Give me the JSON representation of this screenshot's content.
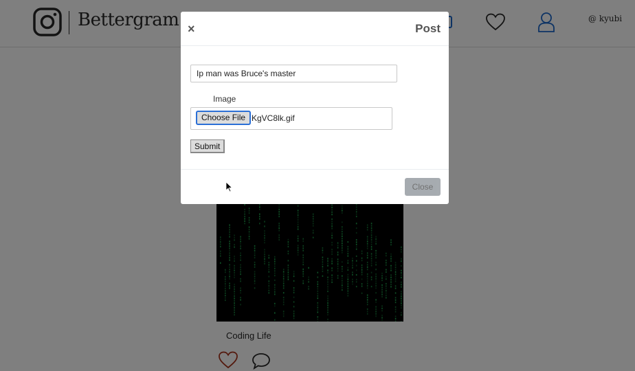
{
  "app": {
    "brand": "Bettergram"
  },
  "nav": {
    "user_handle": "@ kyubi",
    "icons": [
      "instagram-logo-icon",
      "heart-icon",
      "user-icon"
    ]
  },
  "feed": {
    "post": {
      "caption": "Coding Life",
      "image": "matrix-code-gif"
    }
  },
  "modal": {
    "title": "Post",
    "close_x": "×",
    "caption_value": "Ip man was Bruce's master",
    "image_label": "Image",
    "choose_file_label": "Choose File",
    "file_name": "KgVC8lk.gif",
    "submit_label": "Submit",
    "close_label": "Close"
  },
  "colors": {
    "accent_blue": "#2b6fd6",
    "backdrop": "rgba(0,0,0,0.5)",
    "matrix_green": "#1fa84f"
  }
}
